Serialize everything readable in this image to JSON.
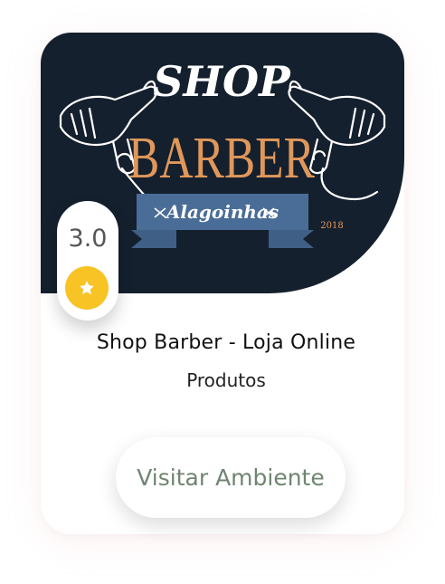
{
  "banner": {
    "logo_line1": "SHOP",
    "logo_line2": "BARBER",
    "ribbon_text": "Alagoinhas",
    "year": "2018",
    "colors": {
      "background": "#15202e",
      "accent": "#e0975a",
      "ribbon": "#3f5f86"
    }
  },
  "rating": {
    "value": "3.0",
    "icon": "star-icon",
    "color": "#f7c325"
  },
  "store": {
    "name": "Shop Barber - Loja Online",
    "category": "Produtos"
  },
  "actions": {
    "visit_label": "Visitar Ambiente",
    "visit_color": "#6f8570"
  }
}
